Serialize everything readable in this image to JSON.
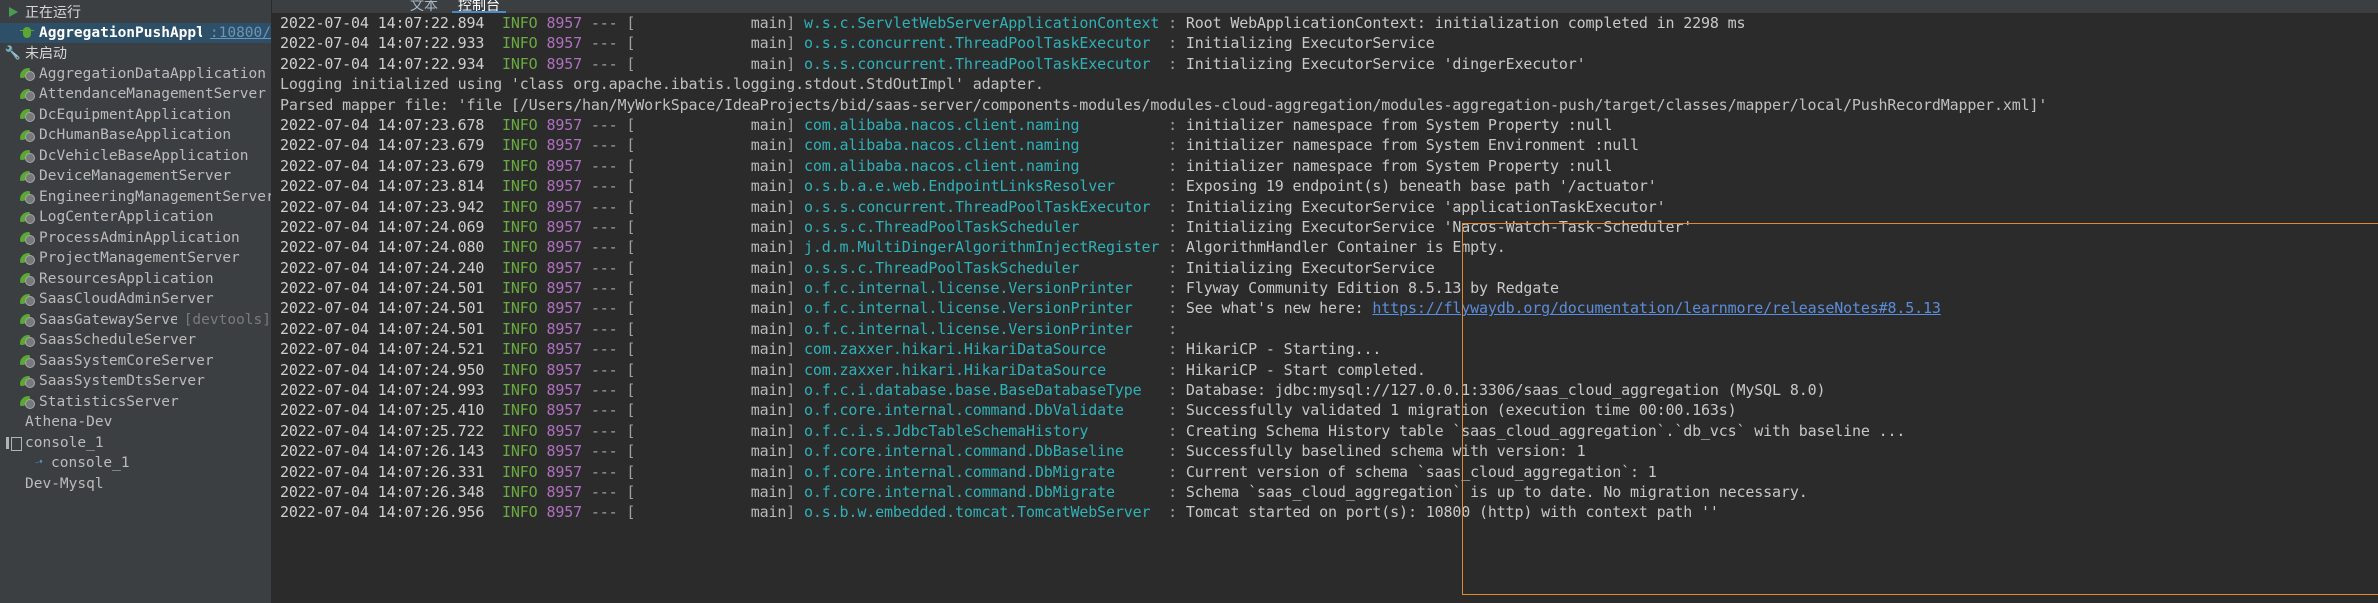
{
  "sidebar": {
    "groups": [
      {
        "label": "正在运行",
        "icon": "run-triangle-icon"
      },
      {
        "label": "未启动",
        "icon": "wrench-icon"
      }
    ],
    "running": [
      {
        "label": "AggregationPushApplication",
        "port": ":10800/",
        "icon": "debug-bug-icon",
        "selected": true
      }
    ],
    "not_started": [
      {
        "label": "AggregationDataApplication"
      },
      {
        "label": "AttendanceManagementServer"
      },
      {
        "label": "DcEquipmentApplication"
      },
      {
        "label": "DcHumanBaseApplication"
      },
      {
        "label": "DcVehicleBaseApplication"
      },
      {
        "label": "DeviceManagementServer"
      },
      {
        "label": "EngineeringManagementServer"
      },
      {
        "label": "LogCenterApplication"
      },
      {
        "label": "ProcessAdminApplication"
      },
      {
        "label": "ProjectManagementServer"
      },
      {
        "label": "ResourcesApplication"
      },
      {
        "label": "SaasCloudAdminServer"
      },
      {
        "label": "SaasGatewayServer",
        "suffix": "[devtools]"
      },
      {
        "label": "SaasScheduleServer"
      },
      {
        "label": "SaasSystemCoreServer"
      },
      {
        "label": "SaasSystemDtsServer"
      },
      {
        "label": "StatisticsServer"
      }
    ],
    "bottom": [
      {
        "label": "Athena-Dev",
        "icon": "none",
        "indent": 0
      },
      {
        "label": "console_1",
        "icon": "console-icon",
        "indent": 0
      },
      {
        "label": "console_1",
        "icon": "arrow-icon",
        "indent": 1
      },
      {
        "label": "Dev-Mysql",
        "icon": "none",
        "indent": 0
      }
    ]
  },
  "tabs": [
    {
      "label": "文本",
      "active": false
    },
    {
      "label": "控制台",
      "active": true
    }
  ],
  "console": {
    "lines": [
      {
        "type": "log",
        "ts": "2022-07-04 14:07:22.894",
        "lvl": "INFO",
        "pid": "8957",
        "thread": "main",
        "logger": "w.s.c.ServletWebServerApplicationContext",
        "msg": "Root WebApplicationContext: initialization completed in 2298 ms"
      },
      {
        "type": "log",
        "ts": "2022-07-04 14:07:22.933",
        "lvl": "INFO",
        "pid": "8957",
        "thread": "main",
        "logger": "o.s.s.concurrent.ThreadPoolTaskExecutor",
        "msg": "Initializing ExecutorService"
      },
      {
        "type": "log",
        "ts": "2022-07-04 14:07:22.934",
        "lvl": "INFO",
        "pid": "8957",
        "thread": "main",
        "logger": "o.s.s.concurrent.ThreadPoolTaskExecutor",
        "msg": "Initializing ExecutorService 'dingerExecutor'"
      },
      {
        "type": "plain",
        "text": "Logging initialized using 'class org.apache.ibatis.logging.stdout.StdOutImpl' adapter."
      },
      {
        "type": "plain",
        "text": "Parsed mapper file: 'file [/Users/han/MyWorkSpace/IdeaProjects/bid/saas-server/components-modules/modules-cloud-aggregation/modules-aggregation-push/target/classes/mapper/local/PushRecordMapper.xml]'"
      },
      {
        "type": "log",
        "ts": "2022-07-04 14:07:23.678",
        "lvl": "INFO",
        "pid": "8957",
        "thread": "main",
        "logger": "com.alibaba.nacos.client.naming",
        "msg": "initializer namespace from System Property :null"
      },
      {
        "type": "log",
        "ts": "2022-07-04 14:07:23.679",
        "lvl": "INFO",
        "pid": "8957",
        "thread": "main",
        "logger": "com.alibaba.nacos.client.naming",
        "msg": "initializer namespace from System Environment :null"
      },
      {
        "type": "log",
        "ts": "2022-07-04 14:07:23.679",
        "lvl": "INFO",
        "pid": "8957",
        "thread": "main",
        "logger": "com.alibaba.nacos.client.naming",
        "msg": "initializer namespace from System Property :null"
      },
      {
        "type": "log",
        "ts": "2022-07-04 14:07:23.814",
        "lvl": "INFO",
        "pid": "8957",
        "thread": "main",
        "logger": "o.s.b.a.e.web.EndpointLinksResolver",
        "msg": "Exposing 19 endpoint(s) beneath base path '/actuator'"
      },
      {
        "type": "log",
        "ts": "2022-07-04 14:07:23.942",
        "lvl": "INFO",
        "pid": "8957",
        "thread": "main",
        "logger": "o.s.s.concurrent.ThreadPoolTaskExecutor",
        "msg": "Initializing ExecutorService 'applicationTaskExecutor'"
      },
      {
        "type": "log",
        "ts": "2022-07-04 14:07:24.069",
        "lvl": "INFO",
        "pid": "8957",
        "thread": "main",
        "logger": "o.s.s.c.ThreadPoolTaskScheduler",
        "msg": "Initializing ExecutorService 'Nacos-Watch-Task-Scheduler'"
      },
      {
        "type": "log",
        "ts": "2022-07-04 14:07:24.080",
        "lvl": "INFO",
        "pid": "8957",
        "thread": "main",
        "logger": "j.d.m.MultiDingerAlgorithmInjectRegister",
        "msg": "AlgorithmHandler Container is Empty."
      },
      {
        "type": "log",
        "ts": "2022-07-04 14:07:24.240",
        "lvl": "INFO",
        "pid": "8957",
        "thread": "main",
        "logger": "o.s.s.c.ThreadPoolTaskScheduler",
        "msg": "Initializing ExecutorService"
      },
      {
        "type": "log",
        "ts": "2022-07-04 14:07:24.501",
        "lvl": "INFO",
        "pid": "8957",
        "thread": "main",
        "logger": "o.f.c.internal.license.VersionPrinter",
        "msg": "Flyway Community Edition 8.5.13 by Redgate"
      },
      {
        "type": "log",
        "ts": "2022-07-04 14:07:24.501",
        "lvl": "INFO",
        "pid": "8957",
        "thread": "main",
        "logger": "o.f.c.internal.license.VersionPrinter",
        "msg": "See what's new here: ",
        "link": "https://flywaydb.org/documentation/learnmore/releaseNotes#8.5.13"
      },
      {
        "type": "log",
        "ts": "2022-07-04 14:07:24.501",
        "lvl": "INFO",
        "pid": "8957",
        "thread": "main",
        "logger": "o.f.c.internal.license.VersionPrinter",
        "msg": ""
      },
      {
        "type": "log",
        "ts": "2022-07-04 14:07:24.521",
        "lvl": "INFO",
        "pid": "8957",
        "thread": "main",
        "logger": "com.zaxxer.hikari.HikariDataSource",
        "msg": "HikariCP - Starting..."
      },
      {
        "type": "log",
        "ts": "2022-07-04 14:07:24.950",
        "lvl": "INFO",
        "pid": "8957",
        "thread": "main",
        "logger": "com.zaxxer.hikari.HikariDataSource",
        "msg": "HikariCP - Start completed."
      },
      {
        "type": "log",
        "ts": "2022-07-04 14:07:24.993",
        "lvl": "INFO",
        "pid": "8957",
        "thread": "main",
        "logger": "o.f.c.i.database.base.BaseDatabaseType",
        "msg": "Database: jdbc:mysql://127.0.0.1:3306/saas_cloud_aggregation (MySQL 8.0)"
      },
      {
        "type": "log",
        "ts": "2022-07-04 14:07:25.410",
        "lvl": "INFO",
        "pid": "8957",
        "thread": "main",
        "logger": "o.f.core.internal.command.DbValidate",
        "msg": "Successfully validated 1 migration (execution time 00:00.163s)"
      },
      {
        "type": "log",
        "ts": "2022-07-04 14:07:25.722",
        "lvl": "INFO",
        "pid": "8957",
        "thread": "main",
        "logger": "o.f.c.i.s.JdbcTableSchemaHistory",
        "msg": "Creating Schema History table `saas_cloud_aggregation`.`db_vcs` with baseline ..."
      },
      {
        "type": "log",
        "ts": "2022-07-04 14:07:26.143",
        "lvl": "INFO",
        "pid": "8957",
        "thread": "main",
        "logger": "o.f.core.internal.command.DbBaseline",
        "msg": "Successfully baselined schema with version: 1"
      },
      {
        "type": "log",
        "ts": "2022-07-04 14:07:26.331",
        "lvl": "INFO",
        "pid": "8957",
        "thread": "main",
        "logger": "o.f.core.internal.command.DbMigrate",
        "msg": "Current version of schema `saas_cloud_aggregation`: 1"
      },
      {
        "type": "log",
        "ts": "2022-07-04 14:07:26.348",
        "lvl": "INFO",
        "pid": "8957",
        "thread": "main",
        "logger": "o.f.core.internal.command.DbMigrate",
        "msg": "Schema `saas_cloud_aggregation` is up to date. No migration necessary."
      },
      {
        "type": "log",
        "ts": "2022-07-04 14:07:26.956",
        "lvl": "INFO",
        "pid": "8957",
        "thread": "main",
        "logger": "o.s.b.w.embedded.tomcat.TomcatWebServer",
        "msg": "Tomcat started on port(s): 10800 (http) with context path ''"
      }
    ]
  },
  "colors": {
    "highlight_border": "#e08a2e",
    "level_info": "#6aab3f",
    "pid": "#b070c0",
    "logger": "#2fb1b8",
    "link": "#5a8ddb",
    "selection": "#2d4f67"
  }
}
